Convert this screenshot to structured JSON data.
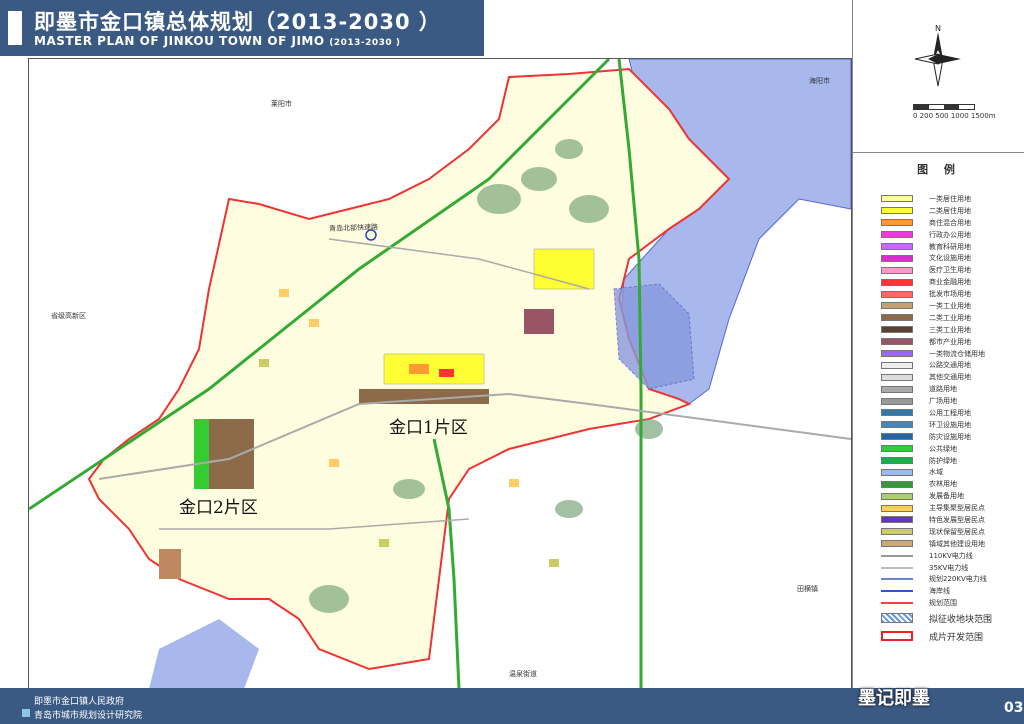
{
  "title": {
    "cn": "即墨市金口镇总体规划（2013-2030 ）",
    "en": "MASTER PLAN OF JINKOU TOWN OF JIMO",
    "en_years": "(2013-2030 )"
  },
  "map_labels": {
    "laiyang": "莱阳市",
    "haiyang": "海阳市",
    "tianheng": "田横镇",
    "wenquan": "温泉街道",
    "provincial_zone": "省级高新区",
    "jinkou1": "金口1片区",
    "jinkou2": "金口2片区",
    "highway_label": "青岛北部快速路"
  },
  "compass_label": "N",
  "scale_text": "0 200 500 1000 1500m",
  "legend": {
    "title": "图 例",
    "items": [
      {
        "label": "一类居住用地",
        "color": "#ffff99",
        "kind": "box"
      },
      {
        "label": "二类居住用地",
        "color": "#ffff33",
        "kind": "box"
      },
      {
        "label": "商住混合用地",
        "color": "#ff9933",
        "kind": "box"
      },
      {
        "label": "行政办公用地",
        "color": "#e040e0",
        "kind": "box"
      },
      {
        "label": "教育科研用地",
        "color": "#cc66ff",
        "kind": "box"
      },
      {
        "label": "文化设施用地",
        "color": "#cc33cc",
        "kind": "box"
      },
      {
        "label": "医疗卫生用地",
        "color": "#ff99cc",
        "kind": "box"
      },
      {
        "label": "商业金融用地",
        "color": "#ff3333",
        "kind": "box"
      },
      {
        "label": "批发市场用地",
        "color": "#ff6666",
        "kind": "box"
      },
      {
        "label": "一类工业用地",
        "color": "#c8a070",
        "kind": "box"
      },
      {
        "label": "二类工业用地",
        "color": "#8c6a4a",
        "kind": "box"
      },
      {
        "label": "三类工业用地",
        "color": "#5a4030",
        "kind": "box"
      },
      {
        "label": "都市产业用地",
        "color": "#995566",
        "kind": "box"
      },
      {
        "label": "一类物流仓储用地",
        "color": "#9966ff",
        "kind": "box"
      },
      {
        "label": "公路交通用地",
        "color": "#eeeeee",
        "kind": "box"
      },
      {
        "label": "其他交通用地",
        "color": "#dddddd",
        "kind": "box"
      },
      {
        "label": "道路用地",
        "color": "#aaaaaa",
        "kind": "box"
      },
      {
        "label": "广场用地",
        "color": "#999999",
        "kind": "box"
      },
      {
        "label": "公用工程用地",
        "color": "#3377aa",
        "kind": "box"
      },
      {
        "label": "环卫设施用地",
        "color": "#4488bb",
        "kind": "box"
      },
      {
        "label": "防灾设施用地",
        "color": "#2266aa",
        "kind": "box"
      },
      {
        "label": "公共绿地",
        "color": "#33cc33",
        "kind": "box"
      },
      {
        "label": "防护绿地",
        "color": "#22aa44",
        "kind": "box"
      },
      {
        "label": "水域",
        "color": "#99bbee",
        "kind": "box"
      },
      {
        "label": "农林用地",
        "color": "#339933",
        "kind": "box"
      },
      {
        "label": "发展备用地",
        "color": "#aad066",
        "kind": "box"
      },
      {
        "label": "主导集聚型居民点",
        "color": "#ffcc66",
        "kind": "box"
      },
      {
        "label": "特色发展型居民点",
        "color": "#6633cc",
        "kind": "box"
      },
      {
        "label": "现状保留型居民点",
        "color": "#cccc66",
        "kind": "box"
      },
      {
        "label": "镇域其他建设用地",
        "color": "#ccaa77",
        "kind": "box"
      },
      {
        "label": "110KV电力线",
        "color": "#999999",
        "kind": "line"
      },
      {
        "label": "35KV电力线",
        "color": "#bbbbbb",
        "kind": "line"
      },
      {
        "label": "规划220KV电力线",
        "color": "#6688cc",
        "kind": "line"
      },
      {
        "label": "海岸线",
        "color": "#3355cc",
        "kind": "line"
      },
      {
        "label": "规划范围",
        "color": "#ee4444",
        "kind": "line"
      }
    ],
    "special": [
      {
        "label": "拟征收地块范围",
        "color": "#6699dd",
        "kind": "hatch"
      },
      {
        "label": "成片开发范围",
        "color": "#ee2222",
        "kind": "redbox"
      }
    ]
  },
  "footer": {
    "org1": "即墨市金口镇人民政府",
    "org2": "青岛市城市规划设计研究院",
    "watermark": "墨记即墨",
    "page_no": "03"
  },
  "colors": {
    "header_bg": "#3a5a84",
    "sea": "#a8b8ec",
    "land": "#fffde0",
    "boundary": "#ee3333",
    "highway": "#33aa33"
  }
}
